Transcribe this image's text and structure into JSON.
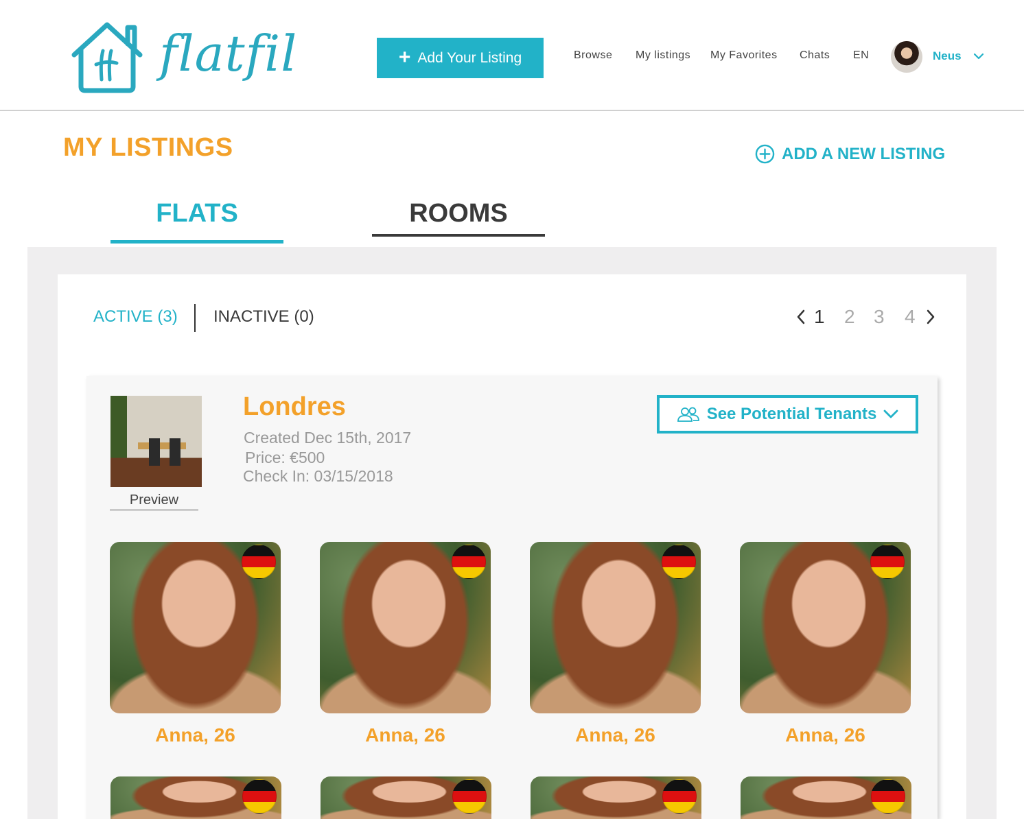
{
  "header": {
    "logo_text": "flatfil",
    "add_listing_label": "Add Your Listing",
    "nav": [
      "Browse",
      "My listings",
      "My Favorites",
      "Chats",
      "EN"
    ],
    "username": "Neus"
  },
  "page": {
    "title": "MY LISTINGS",
    "add_new_label": "ADD A NEW LISTING"
  },
  "type_tabs": {
    "flats": "FLATS",
    "rooms": "ROOMS"
  },
  "status_tabs": {
    "active": "ACTIVE (3)",
    "inactive": "INACTIVE (0)"
  },
  "pagination": {
    "pages": [
      "1",
      "2",
      "3",
      "4"
    ],
    "current": "1"
  },
  "listing": {
    "title": "Londres",
    "created": "Created Dec 15th, 2017",
    "price": "Price: €500",
    "check_in": "Check In: 03/15/2018",
    "preview_label": "Preview",
    "tenants_button_label": "See Potential Tenants"
  },
  "tenants": [
    {
      "name": "Anna, 26",
      "flag": "germany"
    },
    {
      "name": "Anna, 26",
      "flag": "germany"
    },
    {
      "name": "Anna, 26",
      "flag": "germany"
    },
    {
      "name": "Anna, 26",
      "flag": "germany"
    },
    {
      "name": "",
      "flag": "germany"
    },
    {
      "name": "",
      "flag": "germany"
    },
    {
      "name": "",
      "flag": "germany"
    },
    {
      "name": "",
      "flag": "germany"
    }
  ],
  "icons": {
    "logo": "house-icon",
    "add": "plus-icon",
    "user_menu": "chevron-down-icon",
    "add_new": "plus-circle-icon",
    "pager_prev": "chevron-left-icon",
    "pager_next": "chevron-right-icon",
    "tenants": "people-icon",
    "tenants_toggle": "chevron-down-icon"
  },
  "colors": {
    "brand": "#22b2c8",
    "accent": "#f3a12a",
    "text_dark": "#3a3a3a",
    "muted": "#999999",
    "panel_bg": "#efeeef"
  }
}
